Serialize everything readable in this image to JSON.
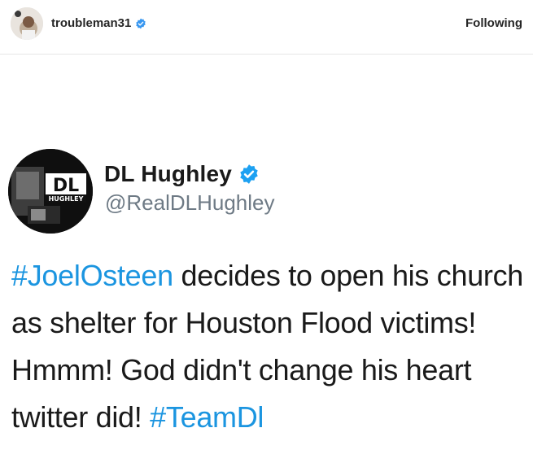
{
  "post_header": {
    "username": "troubleman31",
    "follow_state": "Following"
  },
  "tweet": {
    "display_name": "DL Hughley",
    "handle": "@RealDLHughley",
    "avatar_text": {
      "logo_line1": "DL",
      "logo_line2": "HUGHLEY"
    },
    "body": {
      "hashtag1": "#JoelOsteen",
      "segment1": " decides to open his church as shelter for Houston Flood victims! Hmmm! God didn't change his heart twitter did! ",
      "hashtag2": "#TeamDl"
    }
  },
  "colors": {
    "hashtag": "#1b95e0",
    "verified": "#3897f0",
    "handle": "#6e7a85",
    "text": "#1a1a1a"
  },
  "icons": {
    "instagram_verified": "verified-badge-icon",
    "twitter_verified": "verified-badge-icon"
  }
}
